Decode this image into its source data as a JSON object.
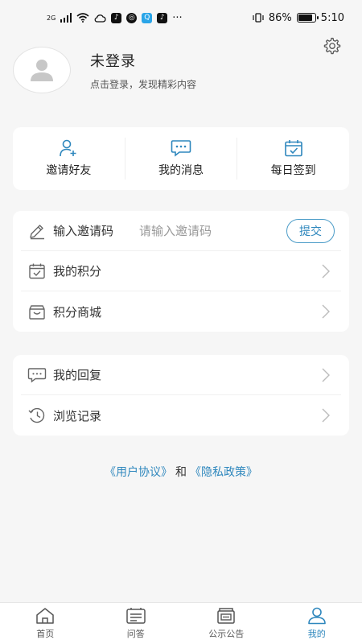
{
  "status_bar": {
    "network": "2G",
    "battery_percent": "86%",
    "battery_level": 0.86,
    "time": "5:10",
    "more": "···"
  },
  "header": {
    "settings_icon": "gear-icon"
  },
  "profile": {
    "name": "未登录",
    "subtitle": "点击登录，发现精彩内容"
  },
  "quick_actions": [
    {
      "label": "邀请好友",
      "icon": "add-user-icon"
    },
    {
      "label": "我的消息",
      "icon": "message-icon"
    },
    {
      "label": "每日签到",
      "icon": "calendar-check-icon"
    }
  ],
  "invite": {
    "label": "输入邀请码",
    "placeholder": "请输入邀请码",
    "submit_label": "提交"
  },
  "menu_group_1": [
    {
      "label": "我的积分",
      "icon": "points-icon"
    },
    {
      "label": "积分商城",
      "icon": "gift-icon"
    }
  ],
  "menu_group_2": [
    {
      "label": "我的回复",
      "icon": "reply-icon"
    },
    {
      "label": "浏览记录",
      "icon": "history-icon"
    }
  ],
  "agreement": {
    "user_agreement": "《用户协议》",
    "and": "和",
    "privacy_policy": "《隐私政策》"
  },
  "tabs": [
    {
      "label": "首页",
      "icon": "home-icon",
      "active": false
    },
    {
      "label": "问答",
      "icon": "qa-icon",
      "active": false
    },
    {
      "label": "公示公告",
      "icon": "notice-icon",
      "active": false
    },
    {
      "label": "我的",
      "icon": "user-icon",
      "active": true
    }
  ],
  "colors": {
    "accent": "#2e87bd",
    "background": "#f6f6f6",
    "card": "#ffffff"
  }
}
